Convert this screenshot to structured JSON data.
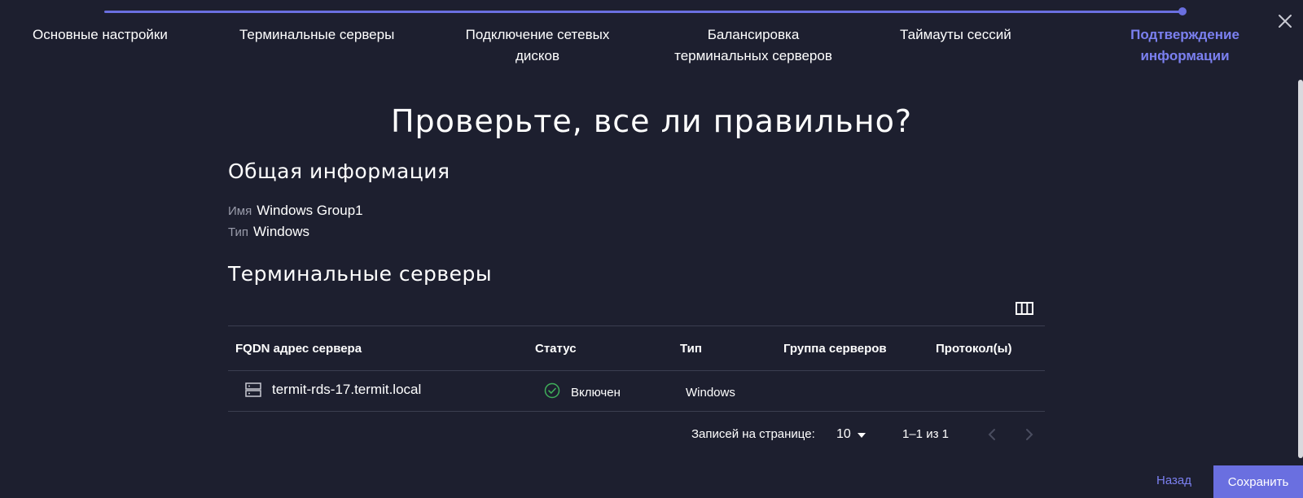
{
  "stepper": {
    "steps": [
      {
        "label": "Основные настройки"
      },
      {
        "label": "Терминальные серверы"
      },
      {
        "label": "Подключение сетевых\nдисков"
      },
      {
        "label": "Балансировка\nтерминальных серверов"
      },
      {
        "label": "Таймауты сессий"
      },
      {
        "label": "Подтверждение\nинформации"
      }
    ],
    "progress": 1.0,
    "accent": "#6a6fe0"
  },
  "close_icon": "close-icon",
  "main": {
    "title": "Проверьте, все ли правильно?",
    "general": {
      "title": "Общая информация",
      "name_label": "Имя",
      "name_value": "Windows Group1",
      "type_label": "Тип",
      "type_value": "Windows"
    },
    "servers": {
      "title": "Терминальные серверы",
      "columns_icon": "columns-icon",
      "headers": {
        "fqdn": "FQDN адрес сервера",
        "status": "Статус",
        "type": "Тип",
        "group": "Группа серверов",
        "protocols": "Протокол(ы)"
      },
      "rows": [
        {
          "fqdn": "termit-rds-17.termit.local",
          "status": "Включен",
          "type": "Windows",
          "group": "",
          "protocols": "",
          "row_icon": "server-icon",
          "status_icon": "check-circle-icon"
        }
      ],
      "pagination": {
        "per_page_label": "Записей на странице:",
        "per_page_value": "10",
        "range": "1–1 из 1"
      }
    }
  },
  "footer": {
    "back_label": "Назад",
    "save_label": "Сохранить"
  }
}
